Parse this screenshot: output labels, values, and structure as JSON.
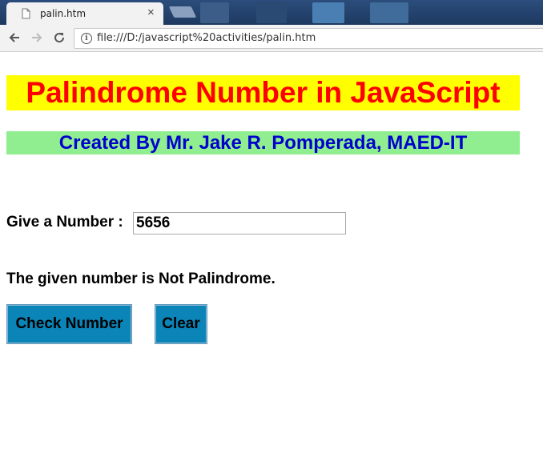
{
  "browser": {
    "tab_title": "palin.htm",
    "tab_close": "×",
    "url": "file:///D:/javascript%20activities/palin.htm",
    "icons": {
      "page": "page-icon",
      "close": "close-icon",
      "back": "back-arrow-icon",
      "forward": "forward-arrow-icon",
      "reload": "reload-icon",
      "info": "info-icon"
    }
  },
  "page": {
    "title": "Palindrome Number in JavaScript",
    "subtitle": "Created By Mr. Jake R. Pomperada, MAED-IT",
    "input_label": "Give a Number :",
    "input_value": "5656",
    "result_text": "The given number is Not Palindrome.",
    "check_button": "Check Number",
    "clear_button": "Clear"
  },
  "colors": {
    "title_bg": "#ffff00",
    "title_text": "#ff0000",
    "subtitle_bg": "#90ee90",
    "subtitle_text": "#0000cd",
    "button_bg": "#0b84b8"
  }
}
